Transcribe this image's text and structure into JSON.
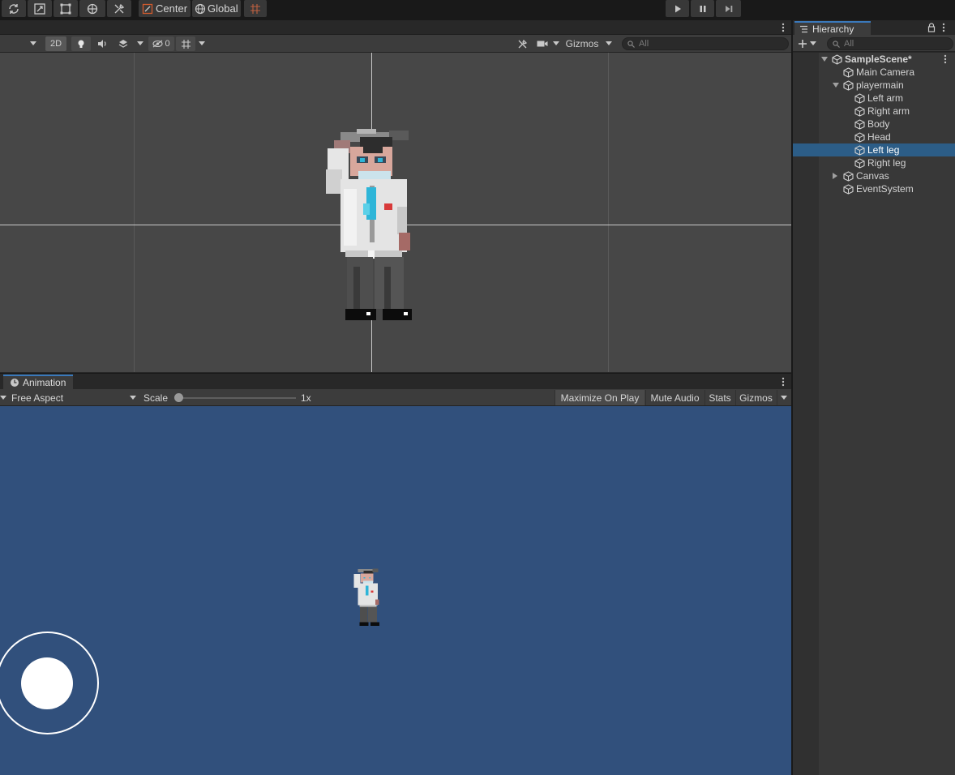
{
  "toolbar": {
    "pivot_label": "Center",
    "space_label": "Global"
  },
  "scene": {
    "mode_2d": "2D",
    "hidden_count": "0",
    "gizmos_label": "Gizmos",
    "search_placeholder": "All"
  },
  "game": {
    "tab_label": "Animation",
    "aspect_label": "Free Aspect",
    "scale_label": "Scale",
    "scale_value": "1x",
    "scale_fraction": 0.0,
    "maximize_label": "Maximize On Play",
    "mute_label": "Mute Audio",
    "stats_label": "Stats",
    "gizmos_label": "Gizmos"
  },
  "hierarchy": {
    "tab_label": "Hierarchy",
    "search_placeholder": "All",
    "items": [
      {
        "label": "SampleScene*",
        "depth": 0,
        "fold": "open",
        "icon": "unity-scene-icon",
        "bold": true
      },
      {
        "label": "Main Camera",
        "depth": 1,
        "fold": "none",
        "icon": "gameobject-cube-icon"
      },
      {
        "label": "playermain",
        "depth": 1,
        "fold": "open",
        "icon": "gameobject-cube-icon"
      },
      {
        "label": "Left arm",
        "depth": 2,
        "fold": "none",
        "icon": "gameobject-cube-icon"
      },
      {
        "label": "Right arm",
        "depth": 2,
        "fold": "none",
        "icon": "gameobject-cube-icon"
      },
      {
        "label": "Body",
        "depth": 2,
        "fold": "none",
        "icon": "gameobject-cube-icon"
      },
      {
        "label": "Head",
        "depth": 2,
        "fold": "none",
        "icon": "gameobject-cube-icon"
      },
      {
        "label": "Left leg",
        "depth": 2,
        "fold": "none",
        "icon": "gameobject-cube-icon",
        "selected": true
      },
      {
        "label": "Right leg",
        "depth": 2,
        "fold": "none",
        "icon": "gameobject-cube-icon"
      },
      {
        "label": "Canvas",
        "depth": 1,
        "fold": "closed",
        "icon": "gameobject-cube-icon"
      },
      {
        "label": "EventSystem",
        "depth": 1,
        "fold": "none",
        "icon": "gameobject-cube-icon"
      }
    ]
  },
  "colors": {
    "game_background": "#31507c",
    "scene_background": "#474747",
    "selection": "#2c5d87",
    "accent": "#3a79bb"
  }
}
